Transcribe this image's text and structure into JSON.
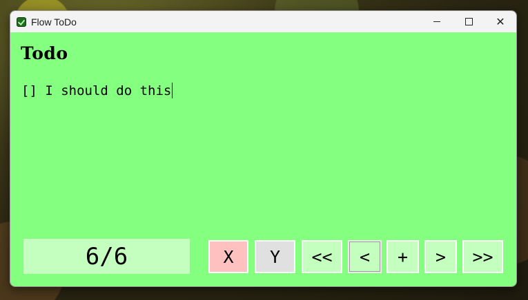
{
  "window": {
    "title": "Flow ToDo",
    "icon": "checkbox-app-icon"
  },
  "title_controls": {
    "minimize": "minimize-icon",
    "maximize": "maximize-icon",
    "close_label": "✕"
  },
  "main": {
    "heading": "Todo",
    "todo_text": "[] I should do this",
    "counter": "6/6"
  },
  "buttons": {
    "x": "X",
    "y": "Y",
    "first": "<<",
    "prev": "<",
    "add": "+",
    "next": ">",
    "last": ">>"
  },
  "colors": {
    "content_bg": "#84ff80",
    "button_bg": "#c4ffc0",
    "x_button_bg": "#ffc0c0",
    "y_button_bg": "#e0e0e0"
  }
}
